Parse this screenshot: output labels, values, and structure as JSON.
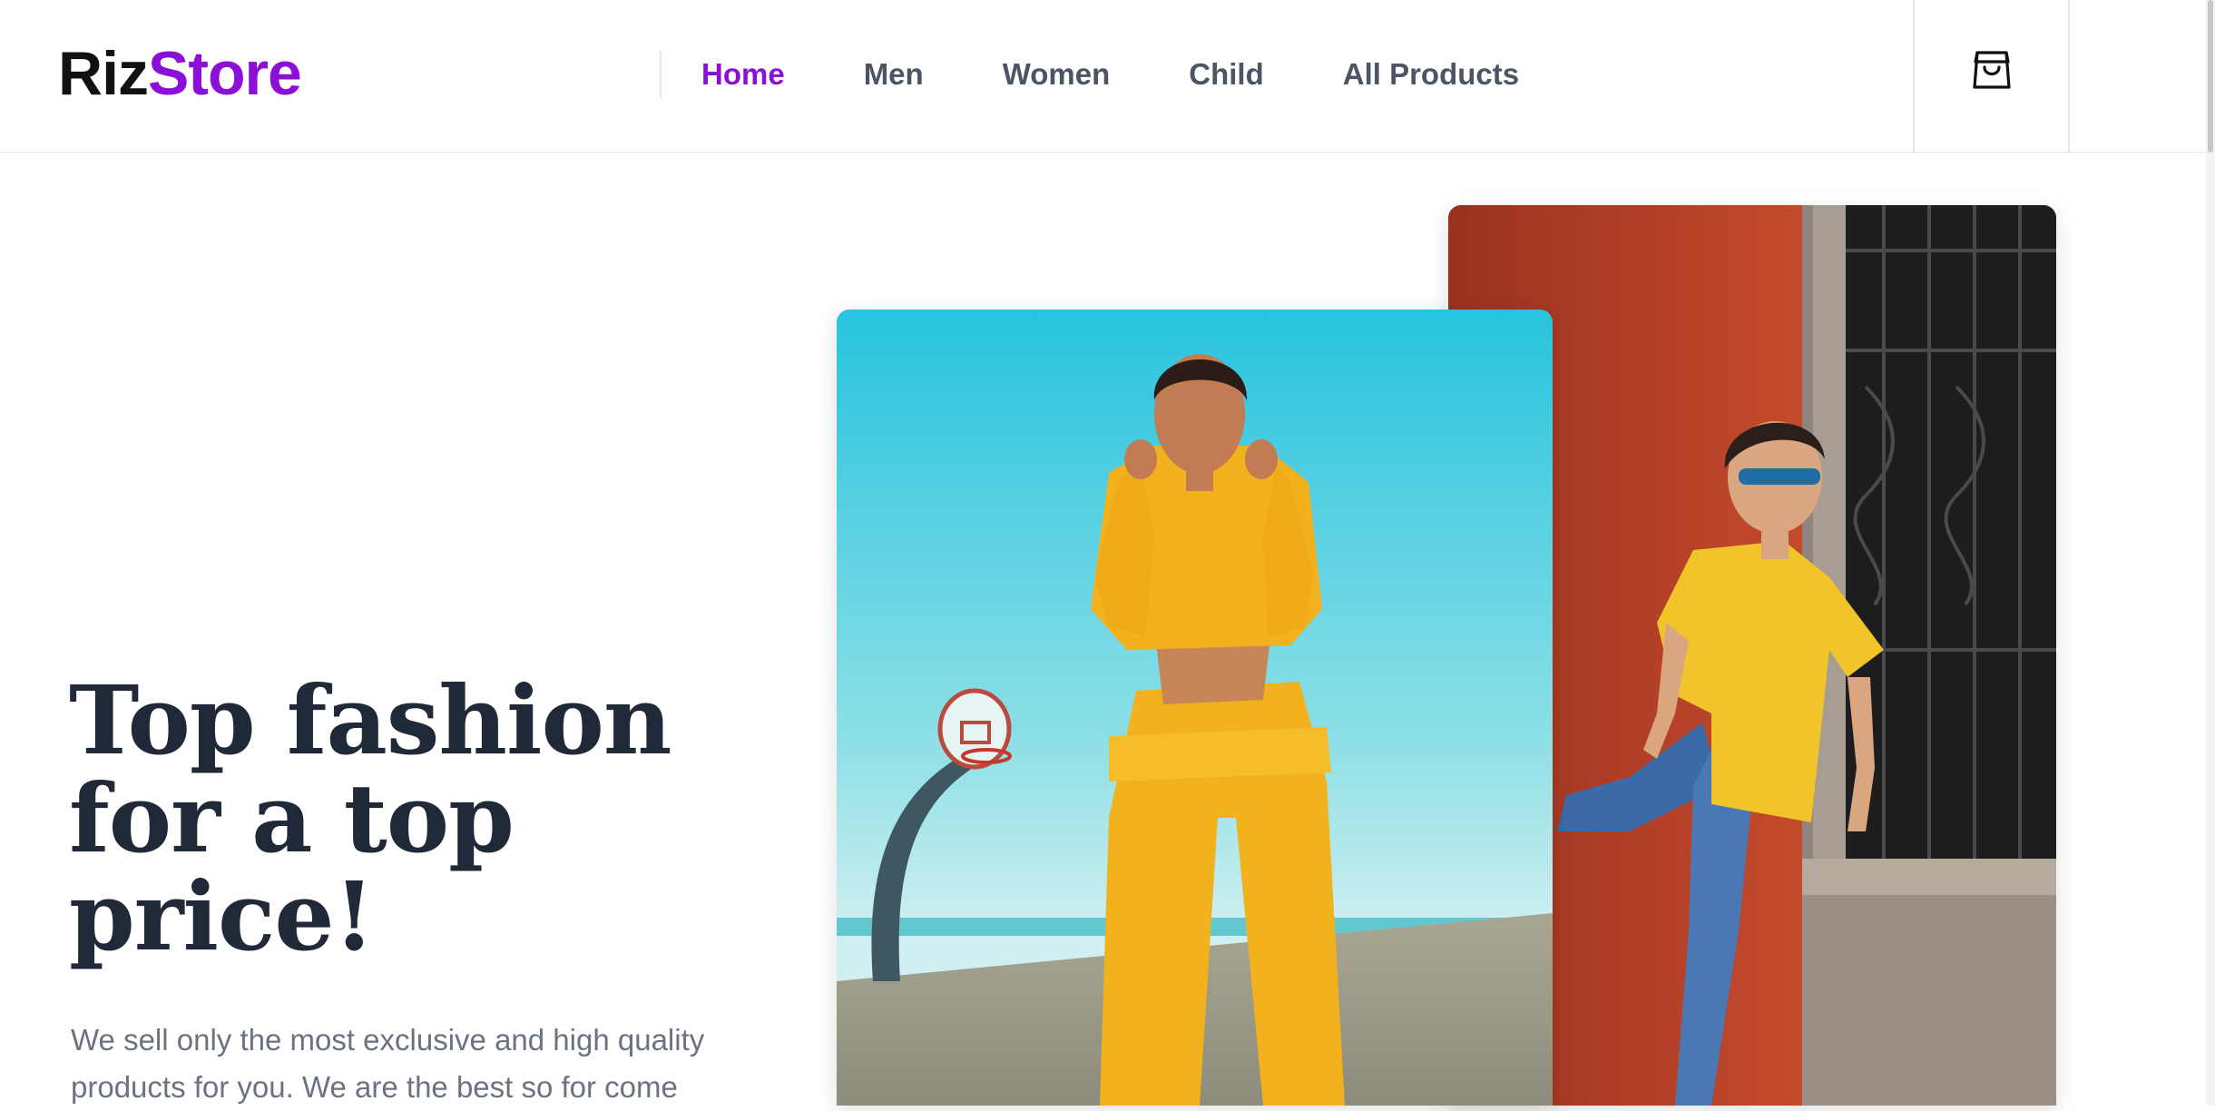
{
  "brand": {
    "name_part1": "Riz",
    "name_part2": "Store",
    "accent_color": "#8b0fd6"
  },
  "nav": {
    "items": [
      {
        "label": "Home",
        "active": true
      },
      {
        "label": "Men",
        "active": false
      },
      {
        "label": "Women",
        "active": false
      },
      {
        "label": "Child",
        "active": false
      },
      {
        "label": "All Products",
        "active": false
      }
    ]
  },
  "header": {
    "cart_icon": "shopping-bag-icon"
  },
  "hero": {
    "title_line1": "Top fashion",
    "title_line2": "for a top",
    "title_line3": "price!",
    "description": "We sell only the most exclusive and high quality products for you. We are the best so for come",
    "image_front": "woman-yellow-tracksuit-basketball-court",
    "image_back": "man-yellow-tshirt-red-wall"
  },
  "colors": {
    "text_dark": "#1f2937",
    "text_muted": "#6b7280",
    "nav_text": "#4b5563"
  }
}
